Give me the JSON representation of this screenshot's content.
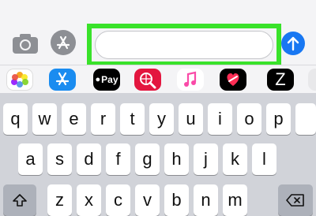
{
  "toolbar": {
    "camera_icon": "camera-icon",
    "appstore_icon": "app-store-icon",
    "message_placeholder": "",
    "send_icon": "send-arrow-icon",
    "highlight_color": "#39e22a"
  },
  "app_drawer": {
    "apps": [
      {
        "name": "photos-app-icon"
      },
      {
        "name": "app-store-app-icon"
      },
      {
        "name": "apple-pay-app-icon",
        "label": "Pay"
      },
      {
        "name": "web-search-app-icon"
      },
      {
        "name": "music-app-icon"
      },
      {
        "name": "digital-touch-app-icon"
      },
      {
        "name": "z-app-icon",
        "label": "Z"
      }
    ]
  },
  "keyboard": {
    "row1": [
      "q",
      "w",
      "e",
      "r",
      "t",
      "y",
      "u",
      "i",
      "o",
      "p"
    ],
    "row2": [
      "a",
      "s",
      "d",
      "f",
      "g",
      "h",
      "j",
      "k",
      "l"
    ],
    "row3": [
      "z",
      "x",
      "c",
      "v",
      "b",
      "n",
      "m"
    ]
  },
  "colors": {
    "accent": "#1877f2",
    "keyboard_bg": "#d1d3d9"
  }
}
